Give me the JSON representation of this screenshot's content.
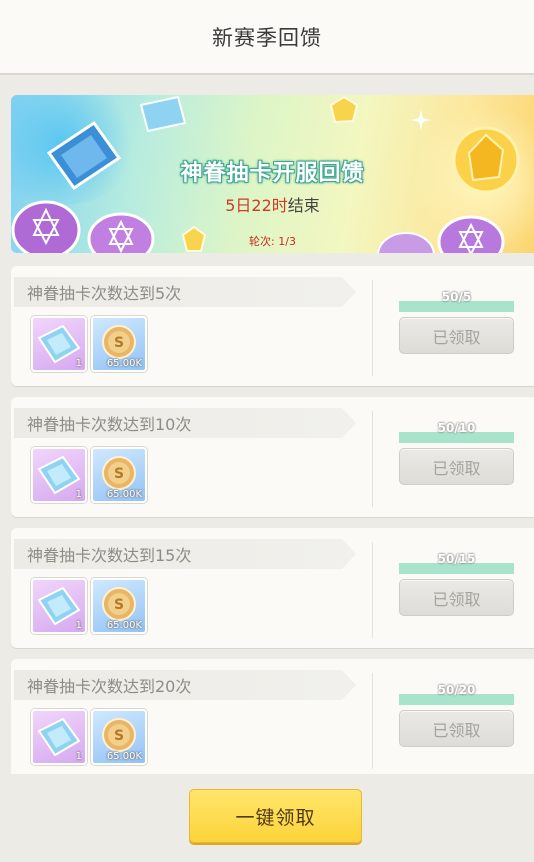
{
  "header": {
    "title": "新赛季回馈"
  },
  "banner": {
    "title": "神眷抽卡开服回馈",
    "timer_days": "5日22时",
    "timer_suffix": "结束",
    "round_label": "轮次: 1/3"
  },
  "tasks": [
    {
      "title": "神眷抽卡次数达到5次",
      "progress": "50/5",
      "progress_fraction": 1.0,
      "button": "已领取",
      "rewards": [
        {
          "icon": "ticket-icon",
          "qty": "1"
        },
        {
          "icon": "coin-icon",
          "qty": "65.00K"
        }
      ]
    },
    {
      "title": "神眷抽卡次数达到10次",
      "progress": "50/10",
      "progress_fraction": 1.0,
      "button": "已领取",
      "rewards": [
        {
          "icon": "ticket-icon",
          "qty": "1"
        },
        {
          "icon": "coin-icon",
          "qty": "65.00K"
        }
      ]
    },
    {
      "title": "神眷抽卡次数达到15次",
      "progress": "50/15",
      "progress_fraction": 1.0,
      "button": "已领取",
      "rewards": [
        {
          "icon": "ticket-icon",
          "qty": "1"
        },
        {
          "icon": "coin-icon",
          "qty": "65.00K"
        }
      ]
    },
    {
      "title": "神眷抽卡次数达到20次",
      "progress": "50/20",
      "progress_fraction": 1.0,
      "button": "已领取",
      "rewards": [
        {
          "icon": "ticket-icon",
          "qty": "1"
        },
        {
          "icon": "coin-icon",
          "qty": "65.00K"
        }
      ]
    }
  ],
  "footer": {
    "claim_all": "一键领取"
  },
  "colors": {
    "progress_fill": "#a8e3cc",
    "claim_all_button": "#fdd33b",
    "timer_highlight": "#d0382b"
  }
}
